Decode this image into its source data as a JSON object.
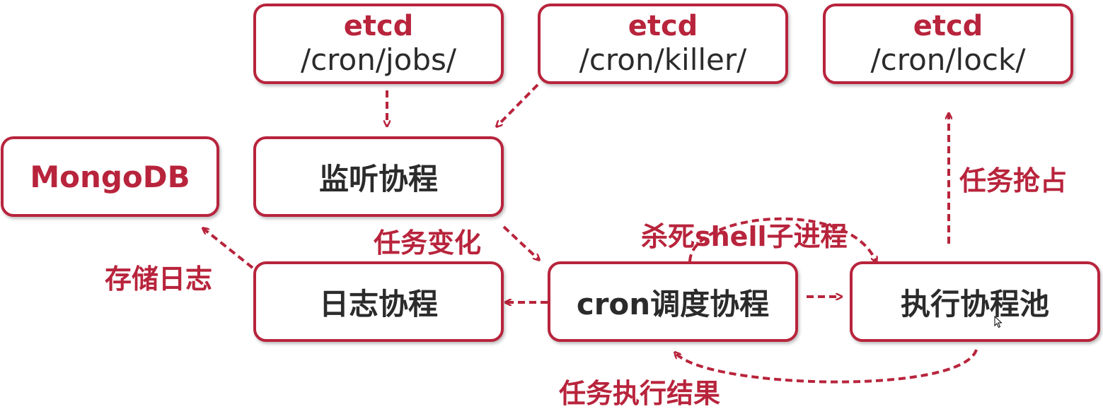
{
  "nodes": {
    "etcd_jobs": {
      "title": "etcd",
      "path": "/cron/jobs/"
    },
    "etcd_killer": {
      "title": "etcd",
      "path": "/cron/killer/"
    },
    "etcd_lock": {
      "title": "etcd",
      "path": "/cron/lock/"
    },
    "mongodb": {
      "label": "MongoDB"
    },
    "watcher": {
      "label": "监听协程"
    },
    "logger": {
      "label": "日志协程"
    },
    "scheduler": {
      "label": "cron调度协程"
    },
    "executor_pool": {
      "label": "执行协程池"
    }
  },
  "edges": {
    "store_log": "存储日志",
    "task_change": "任务变化",
    "kill_shell": "杀死shell子进程",
    "lock_grab": "任务抢占",
    "exec_result": "任务执行结果"
  },
  "colors": {
    "accent": "#b8243c",
    "text": "#2b2b2b"
  }
}
